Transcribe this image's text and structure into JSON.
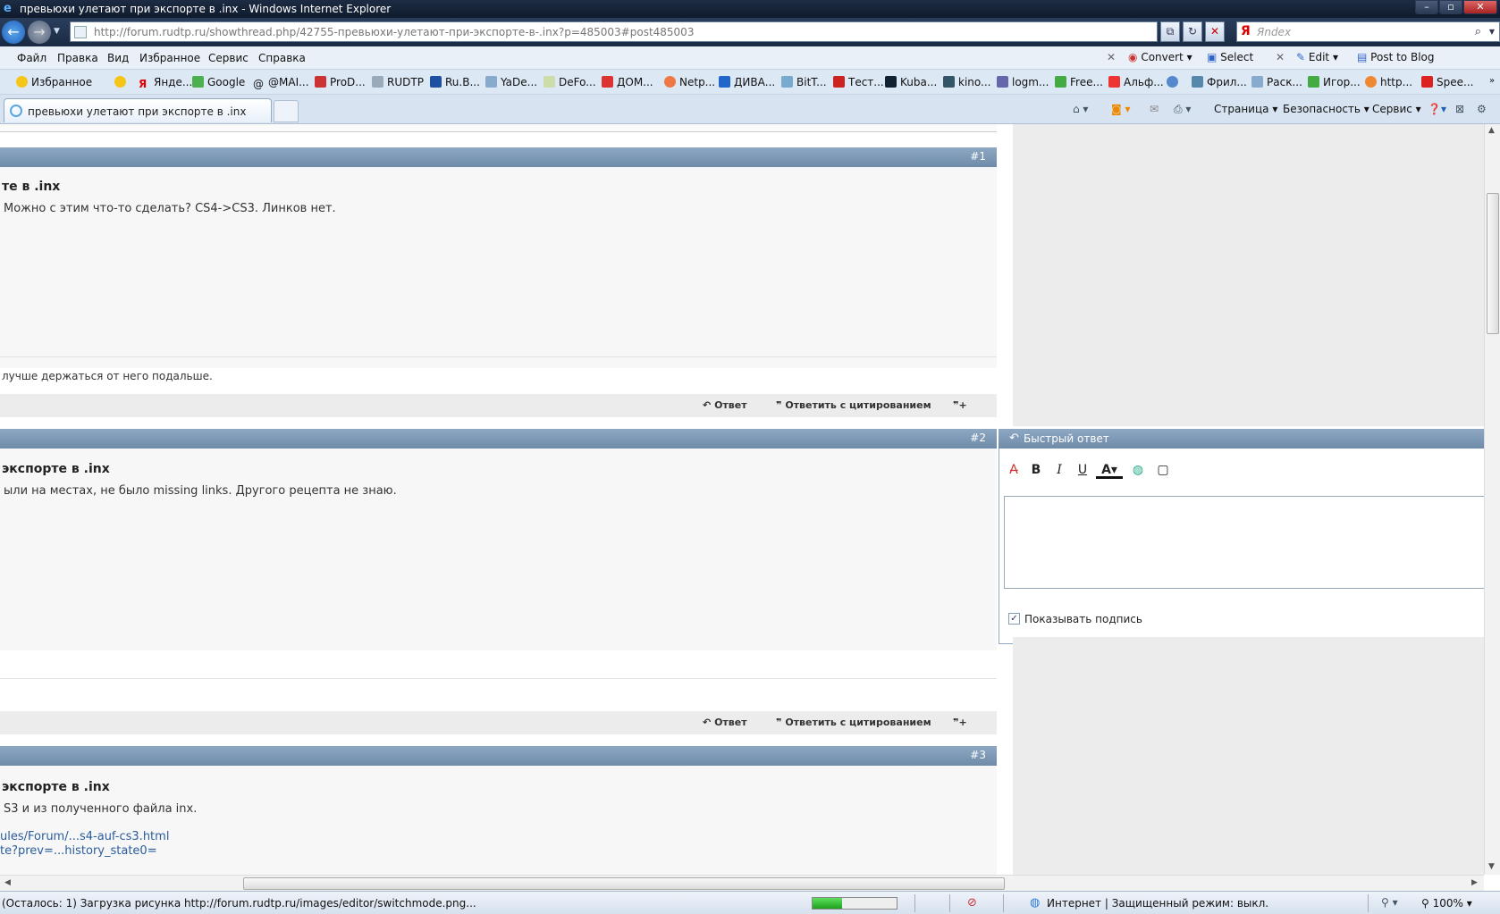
{
  "window": {
    "title": "превьюхи улетают при экспорте в .inx - Windows Internet Explorer"
  },
  "address": {
    "url": "http://forum.rudtp.ru/showthread.php/42755-превьюхи-улетают-при-экспорте-в-.inx?p=485003#post485003"
  },
  "search": {
    "placeholder": "Яndex"
  },
  "menu": [
    "Файл",
    "Правка",
    "Вид",
    "Избранное",
    "Сервис",
    "Справка"
  ],
  "toolbar": {
    "convert": "Convert",
    "select": "Select",
    "edit": "Edit",
    "post_to_blog": "Post to Blog"
  },
  "favorites": {
    "label": "Избранное",
    "items": [
      "Янде...",
      "Google",
      "@MAI...",
      "ProD...",
      "RUDTP",
      "Ru.B...",
      "YaDe...",
      "DeFo...",
      "ДОМ...",
      "Netp...",
      "ДИВА...",
      "BitT...",
      "Тест...",
      "Kuba...",
      "kino...",
      "logm...",
      "Free...",
      "Альф...",
      "",
      "Фрил...",
      "Раск...",
      "Игор...",
      "http...",
      "Spee..."
    ]
  },
  "tab": {
    "title": "превьюхи улетают при экспорте в .inx"
  },
  "commandbar": {
    "page": "Страница",
    "security": "Безопасность",
    "service": "Сервис"
  },
  "posts": [
    {
      "num": "#1",
      "title": "те в .inx",
      "text": "Можно с этим что-то сделать? CS4->CS3. Линков нет.",
      "signature": "лучше держаться от него подальше."
    },
    {
      "num": "#2",
      "title": "экспорте в .inx",
      "text": "ыли на местах, не было missing links. Другого рецепта не знаю."
    },
    {
      "num": "#3",
      "title": "экспорте в .inx",
      "text": "S3 и из полученного файла inx.",
      "links": [
        "ules/Forum/...s4-auf-cs3.html",
        "te?prev=...history_state0="
      ]
    }
  ],
  "actions": {
    "reply": "Ответ",
    "reply_quote": "Ответить с цитированием"
  },
  "quick_reply": {
    "title": "Быстрый ответ",
    "show_signature": "Показывать подпись"
  },
  "status": {
    "message": "(Осталось: 1) Загрузка рисунка http://forum.rudtp.ru/images/editor/switchmode.png...",
    "progress": 0.35,
    "zone": "Интернет | Защищенный режим: выкл.",
    "zoom": "100%"
  }
}
